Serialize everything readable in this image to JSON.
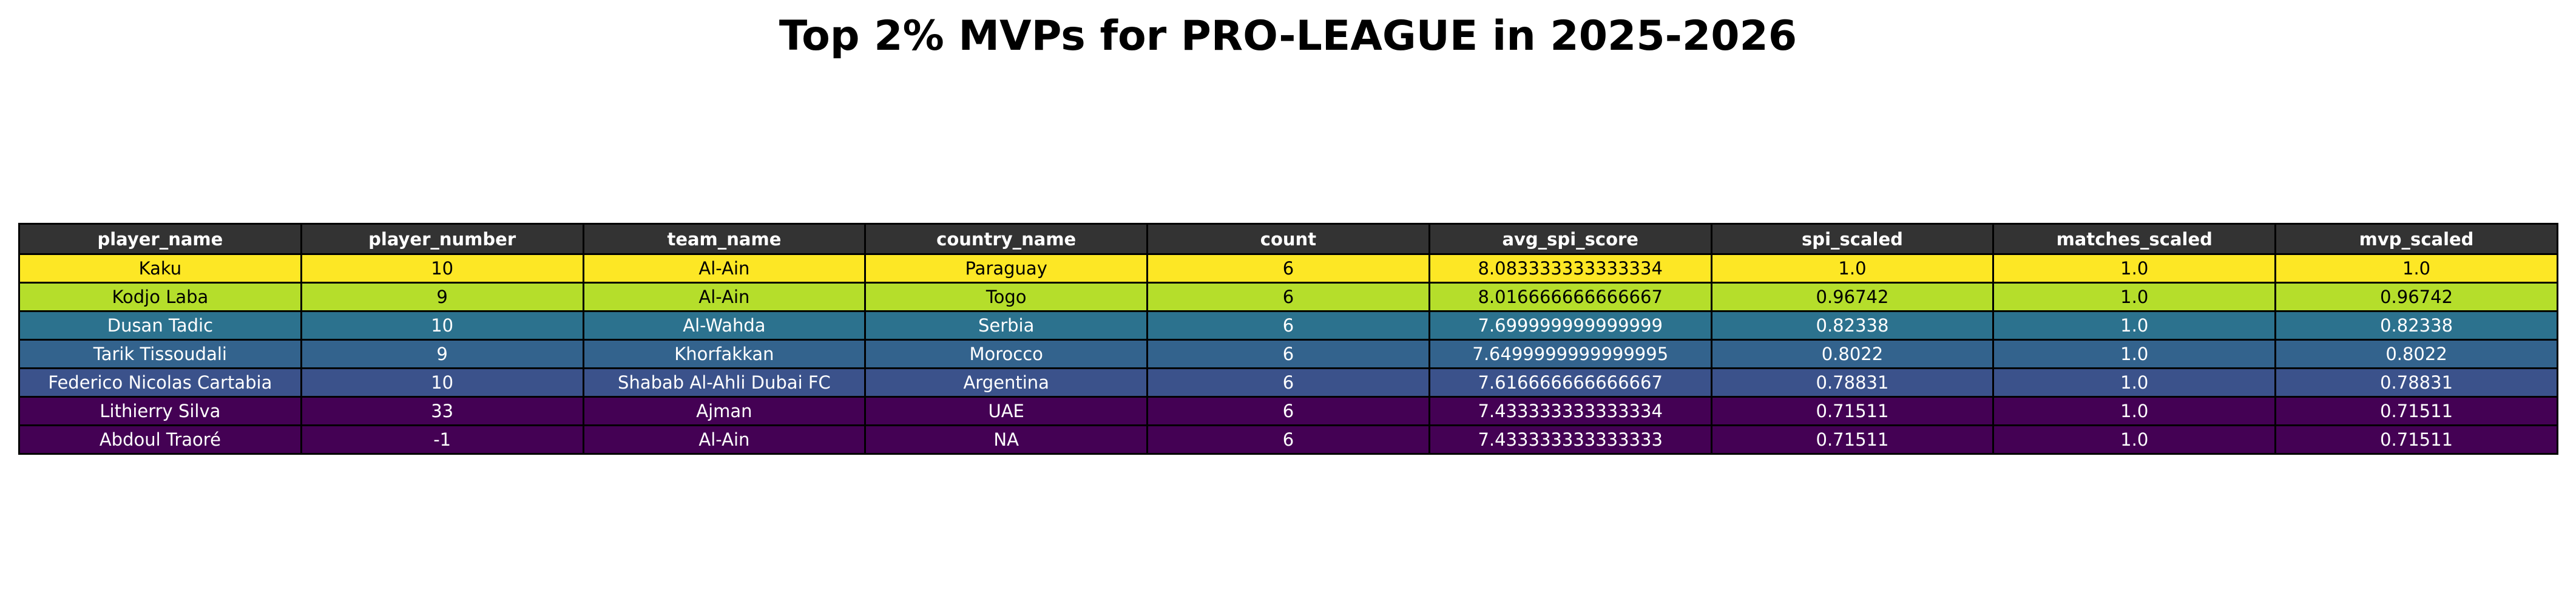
{
  "chart_data": {
    "type": "table",
    "title": "Top 2% MVPs for PRO-LEAGUE in 2025-2026",
    "header_color": "#333333",
    "columns": [
      "player_name",
      "player_number",
      "team_name",
      "country_name",
      "count",
      "avg_spi_score",
      "spi_scaled",
      "matches_scaled",
      "mvp_scaled"
    ],
    "rows": [
      {
        "cells": [
          "Kaku",
          "10",
          "Al-Ain",
          "Paraguay",
          "6",
          "8.083333333333334",
          "1.0",
          "1.0",
          "1.0"
        ],
        "bg": "#fde725",
        "fg": "#000000"
      },
      {
        "cells": [
          "Kodjo Laba",
          "9",
          "Al-Ain",
          "Togo",
          "6",
          "8.016666666666667",
          "0.96742",
          "1.0",
          "0.96742"
        ],
        "bg": "#b5de2b",
        "fg": "#000000"
      },
      {
        "cells": [
          "Dusan Tadic",
          "10",
          "Al-Wahda",
          "Serbia",
          "6",
          "7.699999999999999",
          "0.82338",
          "1.0",
          "0.82338"
        ],
        "bg": "#2c728e",
        "fg": "#ffffff"
      },
      {
        "cells": [
          "Tarik Tissoudali",
          "9",
          "Khorfakkan",
          "Morocco",
          "6",
          "7.6499999999999995",
          "0.8022",
          "1.0",
          "0.8022"
        ],
        "bg": "#33638d",
        "fg": "#ffffff"
      },
      {
        "cells": [
          "Federico Nicolas Cartabia",
          "10",
          "Shabab Al-Ahli Dubai FC",
          "Argentina",
          "6",
          "7.616666666666667",
          "0.78831",
          "1.0",
          "0.78831"
        ],
        "bg": "#3b528b",
        "fg": "#ffffff"
      },
      {
        "cells": [
          "Lithierry Silva",
          "33",
          "Ajman",
          "UAE",
          "6",
          "7.433333333333334",
          "0.71511",
          "1.0",
          "0.71511"
        ],
        "bg": "#440154",
        "fg": "#ffffff"
      },
      {
        "cells": [
          "Abdoul Traoré",
          "-1",
          "Al-Ain",
          "NA",
          "6",
          "7.433333333333333",
          "0.71511",
          "1.0",
          "0.71511"
        ],
        "bg": "#440154",
        "fg": "#ffffff"
      }
    ]
  }
}
